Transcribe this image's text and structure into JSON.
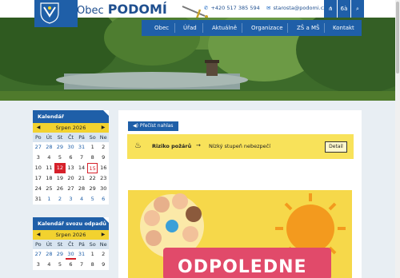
{
  "brand": {
    "prefix": "Obec",
    "name": "PODOMÍ"
  },
  "contact": {
    "phone": "+420 517 385 594",
    "email": "starosta@podomi.cz"
  },
  "topbuttons": {
    "sitemap_icon": "sitemap-icon",
    "accessibility_label": "6à",
    "search_icon": "search-icon"
  },
  "nav": {
    "items": [
      "Obec",
      "Úřad",
      "Aktuálně",
      "Organizace",
      "ZŠ a MŠ",
      "Kontakt"
    ]
  },
  "calendar": {
    "title": "Kalendář",
    "month": "Srpen 2026",
    "weekdays": [
      "Po",
      "Út",
      "St",
      "Čt",
      "Pá",
      "So",
      "Ne"
    ],
    "days": [
      "27",
      "28",
      "29",
      "30",
      "31",
      "1",
      "2",
      "3",
      "4",
      "5",
      "6",
      "7",
      "8",
      "9",
      "10",
      "11",
      "12",
      "13",
      "14",
      "15",
      "16",
      "17",
      "18",
      "19",
      "20",
      "21",
      "22",
      "23",
      "24",
      "25",
      "26",
      "27",
      "28",
      "29",
      "30",
      "31",
      "1",
      "2",
      "3",
      "4",
      "5",
      "6"
    ]
  },
  "waste_calendar": {
    "title": "Kalendář svozu odpadů",
    "month": "Srpen 2026",
    "weekdays": [
      "Po",
      "Út",
      "St",
      "Čt",
      "Pá",
      "So",
      "Ne"
    ],
    "days": [
      "27",
      "28",
      "29",
      "30",
      "31",
      "1",
      "2",
      "3",
      "4",
      "5",
      "6",
      "7",
      "8",
      "9"
    ]
  },
  "main": {
    "listen_label": "Přečíst nahlas",
    "alert": {
      "title": "Riziko požárů",
      "arrow": "→",
      "description": "Nízký stupeň nebezpečí",
      "button": "Detail"
    },
    "poster": {
      "text": "ODPOLEDNE"
    }
  },
  "colors": {
    "brand_blue": "#1f5fa8",
    "accent_yellow": "#f2d22f",
    "alert_yellow": "#f8e25a",
    "today_red": "#d6202a"
  }
}
